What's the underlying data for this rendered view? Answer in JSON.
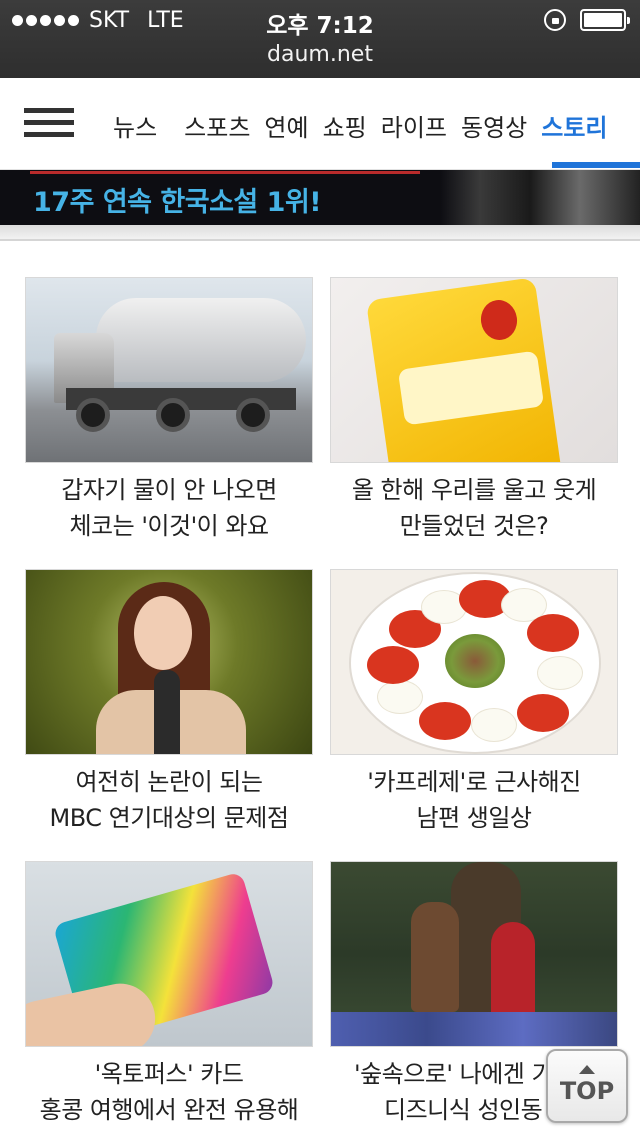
{
  "status_bar": {
    "carrier": "SKT",
    "network": "LTE",
    "time": "오후 7:12",
    "signal_bars": 5,
    "battery_level": 1.0
  },
  "browser": {
    "url": "daum.net"
  },
  "nav": {
    "menu_icon": "hamburger-menu-icon",
    "tabs": [
      "뉴스",
      "스포츠",
      "연예",
      "쇼핑",
      "라이프",
      "동영상",
      "스토리"
    ],
    "active_tab": "스토리",
    "accent_color": "#1f74d9"
  },
  "banner": {
    "text": "17주 연속 한국소설 1위!",
    "text_color": "#46b3e6"
  },
  "articles": [
    {
      "line1": "갑자기 물이 안 나오면",
      "line2": "체코는 '이것'이 와요"
    },
    {
      "line1": "올 한해 우리를 울고 웃게",
      "line2": "만들었던 것은?"
    },
    {
      "line1": "여전히 논란이 되는",
      "line2": "MBC 연기대상의 문제점"
    },
    {
      "line1": "'카프레제'로 근사해진",
      "line2": "남편 생일상"
    },
    {
      "line1": "'옥토퍼스' 카드",
      "line2": "홍콩 여행에서 완전 유용해"
    },
    {
      "line1": "'숲속으로' 나에겐 기",
      "line2": "디즈니식 성인동"
    }
  ],
  "top_button": {
    "label": "TOP",
    "icon": "arrow-up-icon"
  }
}
